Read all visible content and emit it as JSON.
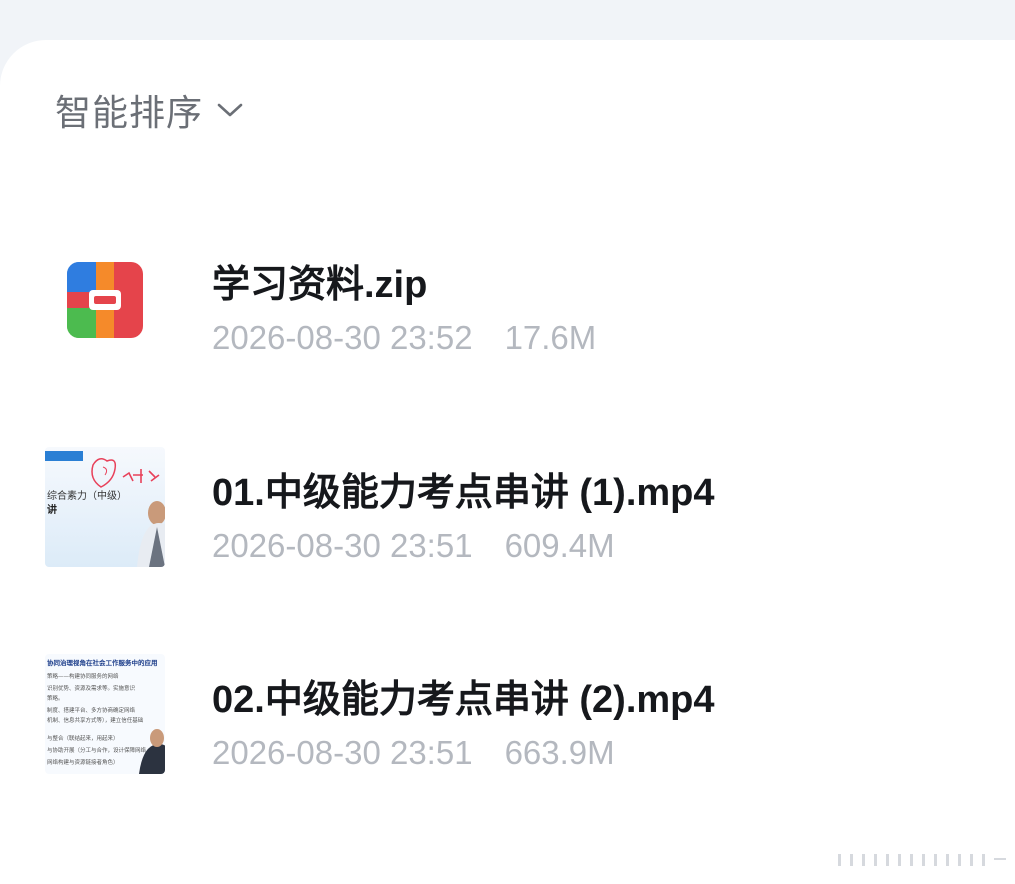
{
  "sort": {
    "label": "智能排序",
    "icon": "chevron-down-icon"
  },
  "files": [
    {
      "name": "学习资料.zip",
      "date": "2026-08-30 23:52",
      "size": "17.6M",
      "icon": "zip-archive-icon",
      "colors": {
        "blue": "#2f7de0",
        "orange": "#f58a2a",
        "red": "#e5444b",
        "green": "#4cbb4f"
      }
    },
    {
      "name": "01.中级能力考点串讲 (1).mp4",
      "date": "2026-08-30 23:51",
      "size": "609.4M",
      "thumb_text": {
        "line1": "综合素力（中级）",
        "line2": "讲",
        "handwriting": "开始"
      }
    },
    {
      "name": "02.中级能力考点串讲 (2).mp4",
      "date": "2026-08-30 23:51",
      "size": "663.9M",
      "thumb_text": {
        "title": "协同治理视角在社会工作服务中的应用",
        "lines": [
          "策略——构建协同服务的网络",
          "识别优势、资源及需求等。实施意识",
          "策略。",
          "制度、搭建平台、多方协商确定网络",
          "机制、信息共享方式等），建立信任基础",
          "与整合（联结起来，用起来）",
          "与协助开展（分工与合作，设计保障网络",
          "网络构建与资源链接者角色）"
        ]
      }
    }
  ],
  "colors": {
    "text": "#16181c",
    "meta": "#b4b8bf",
    "sort": "#6b6f76"
  }
}
